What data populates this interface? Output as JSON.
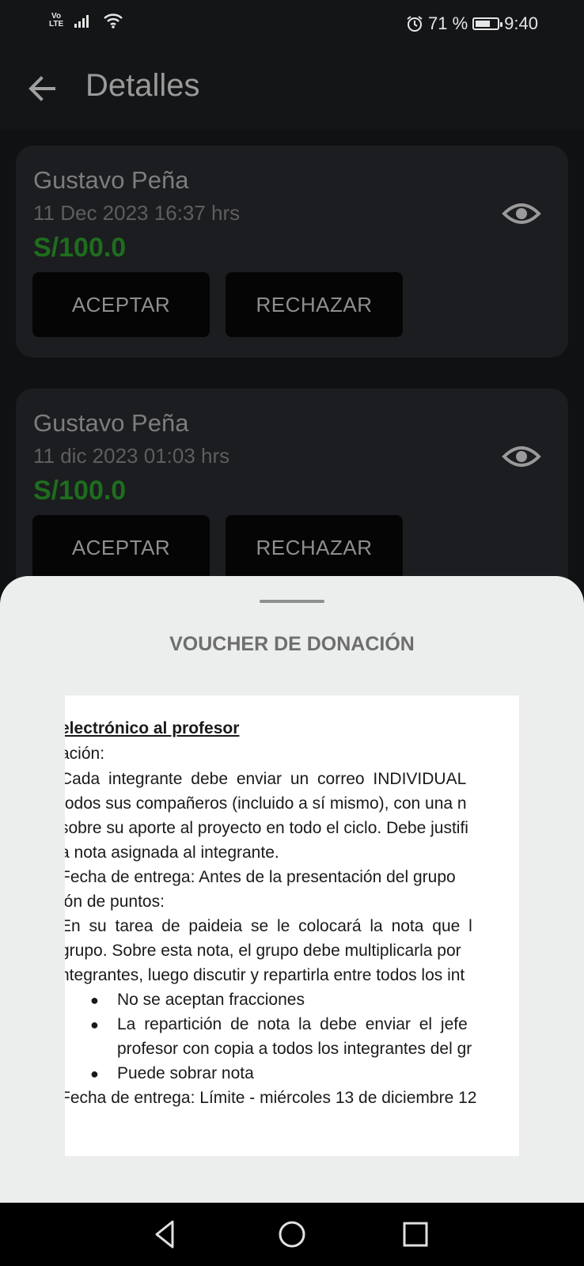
{
  "status_bar": {
    "network": "Vo LTE",
    "battery": "71 %",
    "battery_level": 0.71,
    "time": "9:40"
  },
  "app_bar": {
    "title": "Detalles"
  },
  "donations": [
    {
      "name": "Gustavo Peña",
      "date": "11 Dec 2023 16:37 hrs",
      "amount": "S/100.0",
      "accept_label": "ACEPTAR",
      "reject_label": "RECHAZAR"
    },
    {
      "name": "Gustavo Peña",
      "date": "11 dic 2023 01:03 hrs",
      "amount": "S/100.0",
      "accept_label": "ACEPTAR",
      "reject_label": "RECHAZAR"
    }
  ],
  "sheet": {
    "title": "VOUCHER DE DONACIÓN",
    "voucher_lines": [
      "electrónico al profesor",
      "ación:",
      "Cada integrante debe enviar un correo INDIVIDUAL",
      "todos sus compañeros (incluido a sí mismo), con una n",
      "sobre su aporte al proyecto en todo el ciclo. Debe justifi",
      "a nota asignada al integrante.",
      "Fecha de entrega: Antes de la presentación del grupo",
      "ión de puntos:",
      "En su tarea de paideia se le colocará la nota que l",
      "grupo. Sobre esta nota, el grupo debe multiplicarla por",
      "ntegrantes, luego discutir y repartirla entre todos los int",
      "No se aceptan fracciones",
      "La repartición de nota la debe enviar el jefe",
      "profesor con copia a todos los integrantes del gr",
      "Puede sobrar nota",
      "Fecha de entrega: Límite - miércoles 13 de diciembre 12"
    ]
  },
  "colors": {
    "amount_green": "#1e6d1e",
    "card_bg": "#1c1d20",
    "sheet_bg": "#eceeed"
  }
}
